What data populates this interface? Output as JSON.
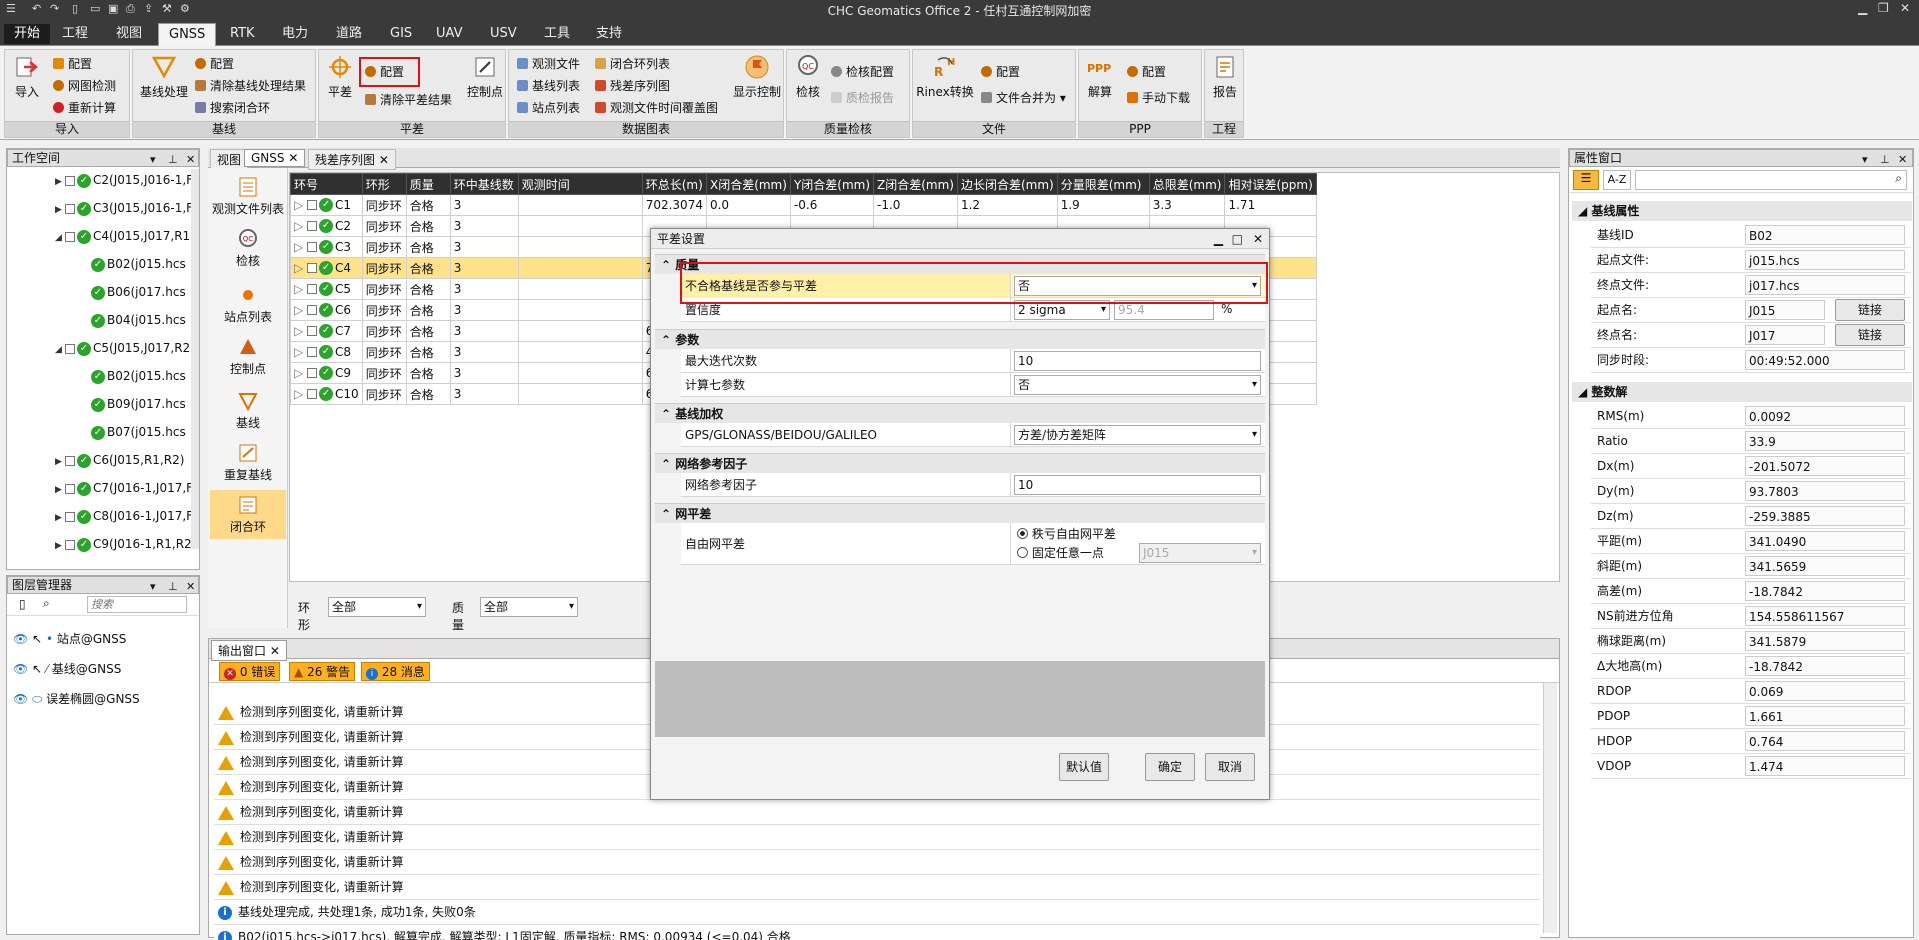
{
  "app": {
    "title": "CHC Geomatics Office 2 - 任村互通控制网加密"
  },
  "menu": {
    "tabs": [
      "开始",
      "工程",
      "视图",
      "GNSS",
      "RTK",
      "电力",
      "道路",
      "GIS",
      "UAV",
      "USV",
      "工具",
      "支持"
    ],
    "active": "GNSS"
  },
  "ribbon": {
    "import": {
      "label": "导入",
      "group": "导入",
      "config": "配置",
      "net_check": "网图检测",
      "recalc": "重新计算"
    },
    "baseline": {
      "label": "基线处理",
      "group": "基线",
      "config": "配置",
      "clear": "清除基线处理结果",
      "search_loop": "搜索闭合环"
    },
    "adjust": {
      "label": "平差",
      "group": "平差",
      "config": "配置",
      "clear": "清除平差结果",
      "control": "控制点"
    },
    "reports": {
      "group": "数据图表",
      "obs_file": "观测文件",
      "loop_list": "闭合环列表",
      "baseline_list": "基线列表",
      "residual": "残差序列图",
      "station_list": "站点列表",
      "coverage": "观测文件时间覆盖图",
      "display": "显示控制"
    },
    "qc": {
      "group": "质量检核",
      "check": "检核",
      "check_cfg": "检核配置",
      "qc_report": "质检报告"
    },
    "file": {
      "group": "文件",
      "rinex": "Rinex转换",
      "config": "配置",
      "merge": "文件合并为"
    },
    "ppp": {
      "group": "PPP",
      "solve": "解算",
      "config": "配置",
      "download": "手动下载"
    },
    "project": {
      "group": "工程",
      "report": "报告"
    }
  },
  "workspace": {
    "title": "工作空间",
    "items": [
      {
        "label": "C2(J015,J016-1,F",
        "type": "loop",
        "level": 1
      },
      {
        "label": "C3(J015,J016-1,F",
        "type": "loop",
        "level": 1
      },
      {
        "label": "C4(J015,J017,R1",
        "type": "loop",
        "level": 1,
        "expanded": true
      },
      {
        "label": "B02(j015.hcs",
        "type": "baseline",
        "level": 2
      },
      {
        "label": "B06(j017.hcs",
        "type": "baseline",
        "level": 2
      },
      {
        "label": "B04(j015.hcs",
        "type": "baseline",
        "level": 2
      },
      {
        "label": "C5(J015,J017,R2",
        "type": "loop",
        "level": 1,
        "expanded": true
      },
      {
        "label": "B02(j015.hcs",
        "type": "baseline",
        "level": 2
      },
      {
        "label": "B09(j017.hcs",
        "type": "baseline",
        "level": 2
      },
      {
        "label": "B07(j015.hcs",
        "type": "baseline",
        "level": 2
      },
      {
        "label": "C6(J015,R1,R2)",
        "type": "loop",
        "level": 1
      },
      {
        "label": "C7(J016-1,J017,F",
        "type": "loop",
        "level": 1
      },
      {
        "label": "C8(J016-1,J017,F",
        "type": "loop",
        "level": 1
      },
      {
        "label": "C9(J016-1,R1,R2",
        "type": "loop",
        "level": 1
      }
    ]
  },
  "layers": {
    "title": "图层管理器",
    "search_placeholder": "搜索",
    "items": [
      "站点@GNSS",
      "基线@GNSS",
      "误差椭圆@GNSS"
    ]
  },
  "doctabs": [
    "视图",
    "GNSS",
    "残差序列图"
  ],
  "sidetools": [
    "观测文件列表",
    "检核",
    "站点列表",
    "控制点",
    "基线",
    "重复基线",
    "闭合环"
  ],
  "grid": {
    "headers": [
      "环号",
      "环形",
      "质量",
      "环中基线数",
      "观测时间",
      "环总长(m)",
      "X闭合差(mm)",
      "Y闭合差(mm)",
      "Z闭合差(mm)",
      "边长闭合差(mm)",
      "分量限差(mm)",
      "总限差(mm)",
      "相对误差(ppm)"
    ],
    "rows": [
      [
        "C1",
        "同步环",
        "合格",
        "3",
        "",
        "702.3074",
        "0.0",
        "-0.6",
        "-1.0",
        "1.2",
        "1.9",
        "3.3",
        "1.71"
      ],
      [
        "C2",
        "同步环",
        "合格",
        "3",
        "",
        "",
        "",
        "",
        "",
        "",
        "",
        "",
        ""
      ],
      [
        "C3",
        "同步环",
        "合格",
        "3",
        "",
        "",
        "",
        "",
        "",
        "",
        "",
        "",
        ""
      ],
      [
        "C4",
        "同步环",
        "合格",
        "3",
        "",
        "7",
        "",
        "",
        "",
        "",
        "",
        "",
        ""
      ],
      [
        "C5",
        "同步环",
        "合格",
        "3",
        "",
        "",
        "",
        "",
        "",
        "",
        "",
        "",
        ""
      ],
      [
        "C6",
        "同步环",
        "合格",
        "3",
        "",
        "",
        "",
        "",
        "",
        "",
        "",
        "",
        ""
      ],
      [
        "C7",
        "同步环",
        "合格",
        "3",
        "",
        "6",
        "",
        "",
        "",
        "",
        "",
        "",
        ""
      ],
      [
        "C8",
        "同步环",
        "合格",
        "3",
        "",
        "4",
        "",
        "",
        "",
        "",
        "",
        "",
        ""
      ],
      [
        "C9",
        "同步环",
        "合格",
        "3",
        "",
        "6",
        "",
        "",
        "",
        "",
        "",
        "",
        ""
      ],
      [
        "C10",
        "同步环",
        "合格",
        "3",
        "",
        "6",
        "",
        "",
        "",
        "",
        "",
        "",
        ""
      ]
    ],
    "selected": 3,
    "filter_shape_label": "环形",
    "filter_shape_value": "全部",
    "filter_quality_label": "质量",
    "filter_quality_value": "全部"
  },
  "output": {
    "title": "输出窗口",
    "errors": "0 错误",
    "warnings": "26 警告",
    "messages": "28 消息",
    "lines": [
      {
        "type": "warn",
        "text": "检测到序列图变化, 请重新计算"
      },
      {
        "type": "warn",
        "text": "检测到序列图变化, 请重新计算"
      },
      {
        "type": "warn",
        "text": "检测到序列图变化, 请重新计算"
      },
      {
        "type": "warn",
        "text": "检测到序列图变化, 请重新计算"
      },
      {
        "type": "warn",
        "text": "检测到序列图变化, 请重新计算"
      },
      {
        "type": "warn",
        "text": "检测到序列图变化, 请重新计算"
      },
      {
        "type": "warn",
        "text": "检测到序列图变化, 请重新计算"
      },
      {
        "type": "warn",
        "text": "检测到序列图变化, 请重新计算"
      },
      {
        "type": "info",
        "text": "基线处理完成, 共处理1条, 成功1条, 失败0条"
      },
      {
        "type": "info",
        "text": "B02(j015.hcs->j017.hcs), 解算完成, 解算类型: L1固定解, 质量指标: RMS: 0.00934 (<=0.04) 合格"
      }
    ]
  },
  "dialog": {
    "title": "平差设置",
    "sections": {
      "quality": "质量",
      "params": "参数",
      "weight": "基线加权",
      "netref": "网络参考因子",
      "netadj": "网平差"
    },
    "unqualified_label": "不合格基线是否参与平差",
    "unqualified_value": "否",
    "confidence_label": "置信度",
    "confidence_value": "2 sigma",
    "confidence_pct": "95.4",
    "pct_unit": "%",
    "max_iter_label": "最大迭代次数",
    "max_iter_value": "10",
    "seven_label": "计算七参数",
    "seven_value": "否",
    "gnss_label": "GPS/GLONASS/BEIDOU/GALILEO",
    "gnss_value": "方差/协方差矩阵",
    "netref_label": "网络参考因子",
    "netref_value": "10",
    "free_label": "自由网平差",
    "opt_rank": "秩亏自由网平差",
    "opt_fixed": "固定任意一点",
    "fixed_point": "J015",
    "btn_default": "默认值",
    "btn_ok": "确定",
    "btn_cancel": "取消"
  },
  "properties": {
    "title": "属性窗口",
    "sort_az": "A-Z",
    "sec_baseline": "基线属性",
    "sec_int": "整数解",
    "link": "链接",
    "baseline": [
      {
        "k": "基线ID",
        "v": "B02"
      },
      {
        "k": "起点文件:",
        "v": "j015.hcs"
      },
      {
        "k": "终点文件:",
        "v": "j017.hcs"
      },
      {
        "k": "起点名:",
        "v": "J015",
        "link": true
      },
      {
        "k": "终点名:",
        "v": "J017",
        "link": true
      },
      {
        "k": "同步时段:",
        "v": "00:49:52.000"
      }
    ],
    "integer": [
      {
        "k": "RMS(m)",
        "v": "0.0092"
      },
      {
        "k": "Ratio",
        "v": "33.9"
      },
      {
        "k": "Dx(m)",
        "v": "-201.5072"
      },
      {
        "k": "Dy(m)",
        "v": "93.7803"
      },
      {
        "k": "Dz(m)",
        "v": "-259.3885"
      },
      {
        "k": "平距(m)",
        "v": "341.0490"
      },
      {
        "k": "斜距(m)",
        "v": "341.5659"
      },
      {
        "k": "高差(m)",
        "v": "-18.7842"
      },
      {
        "k": "NS前进方位角",
        "v": "154.558611567"
      },
      {
        "k": "椭球距离(m)",
        "v": "341.5879"
      },
      {
        "k": "Δ大地高(m)",
        "v": "-18.7842"
      },
      {
        "k": "RDOP",
        "v": "0.069"
      },
      {
        "k": "PDOP",
        "v": "1.661"
      },
      {
        "k": "HDOP",
        "v": "0.764"
      },
      {
        "k": "VDOP",
        "v": "1.474"
      }
    ]
  }
}
